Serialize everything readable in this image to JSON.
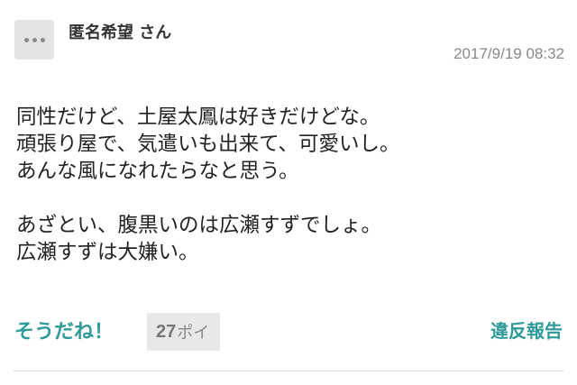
{
  "comment": {
    "author": "匿名希望 さん",
    "timestamp": "2017/9/19 08:32",
    "lines": [
      "同性だけど、土屋太鳳は好きだけどな。",
      "頑張り屋で、気遣いも出来て、可愛いし。",
      "あんな風になれたらなと思う。",
      "",
      "あざとい、腹黒いのは広瀬すずでしょ。",
      "広瀬すずは大嫌い。"
    ],
    "agree_label": "そうだね！",
    "vote_count": "27",
    "vote_unit": "ポイ",
    "report_label": "違反報告"
  },
  "colors": {
    "accent": "#2e9a9a",
    "text": "#222222",
    "muted": "#888888",
    "badge_bg": "#e8e8e8",
    "avatar_bg": "#e3e3e3"
  }
}
